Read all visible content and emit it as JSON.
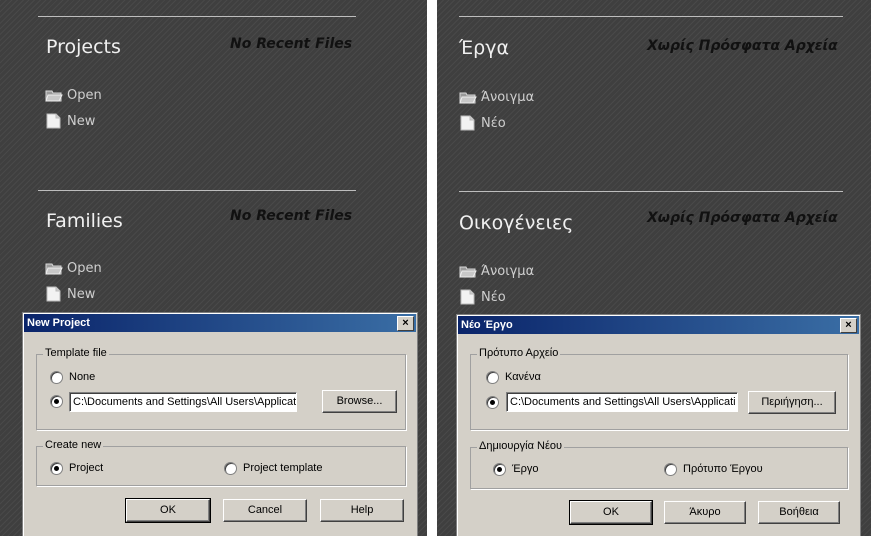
{
  "left": {
    "projects": {
      "title": "Projects",
      "no_recent": "No Recent Files",
      "open": "Open",
      "new": "New"
    },
    "families": {
      "title": "Families",
      "no_recent": "No Recent Files",
      "open": "Open",
      "new": "New"
    },
    "dialog": {
      "title": "New Project",
      "close": "×",
      "template_group": "Template file",
      "none_option": "None",
      "path_value": "C:\\Documents and Settings\\All Users\\Applicati",
      "browse_button": "Browse...",
      "create_group": "Create new",
      "project_option": "Project",
      "template_option": "Project template",
      "ok": "OK",
      "cancel": "Cancel",
      "help": "Help"
    }
  },
  "right": {
    "projects": {
      "title": "Έργα",
      "no_recent": "Χωρίς Πρόσφατα Αρχεία",
      "open": "Άνοιγμα",
      "new": "Νέο"
    },
    "families": {
      "title": "Οικογένειες",
      "no_recent": "Χωρίς Πρόσφατα Αρχεία",
      "open": "Άνοιγμα",
      "new": "Νέο"
    },
    "dialog": {
      "title": "Νέο Έργο",
      "close": "×",
      "template_group": "Πρότυπο Αρχείο",
      "none_option": "Κανένα",
      "path_value": "C:\\Documents and Settings\\All Users\\Applicati",
      "browse_button": "Περιήγηση...",
      "create_group": "Δημιουργία Νέου",
      "project_option": "Έργο",
      "template_option": "Πρότυπο Έργου",
      "ok": "OK",
      "cancel": "Άκυρο",
      "help": "Βοήθεια"
    }
  },
  "icons": {
    "open": "folder-open-icon",
    "new": "new-document-icon"
  },
  "colors": {
    "panel_bg": "#3f3f3f",
    "titlebar": "#0a246a",
    "dialog_bg": "#d4d0c8"
  }
}
